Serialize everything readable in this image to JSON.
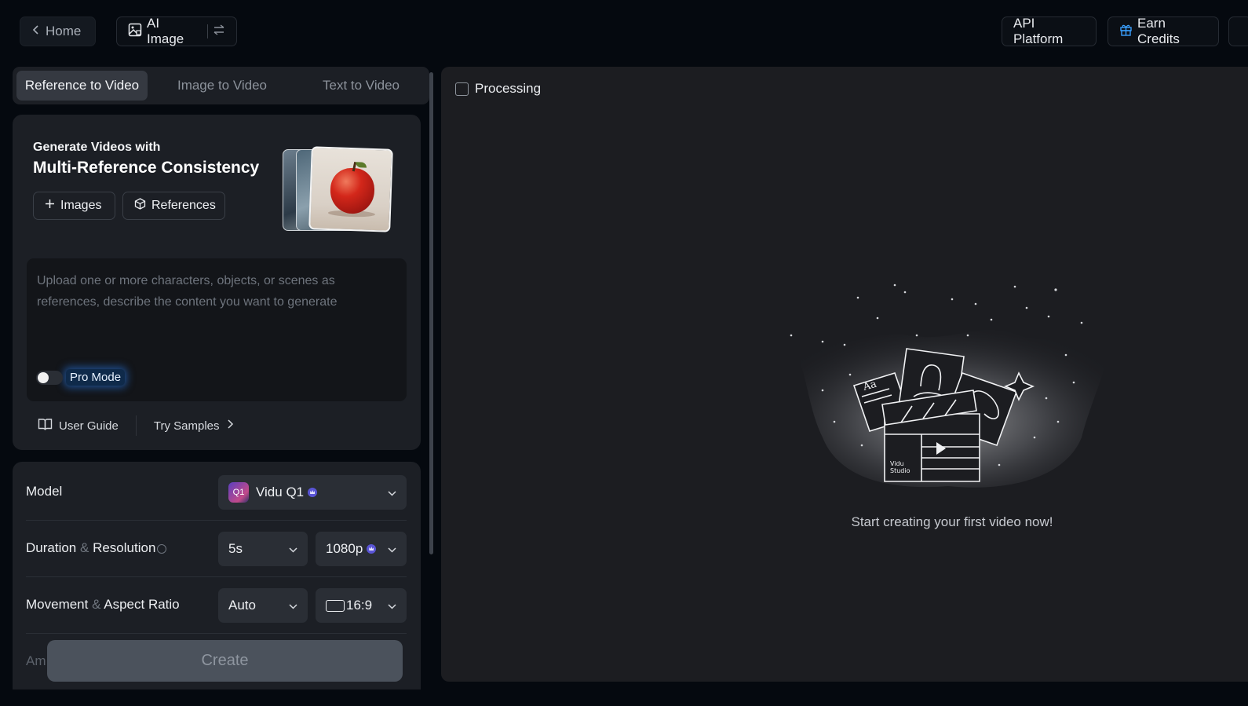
{
  "topbar": {
    "home_label": "Home",
    "ai_image_label": "AI Image",
    "api_platform_label": "API Platform",
    "earn_credits_label": "Earn Credits"
  },
  "tabs": [
    {
      "label": "Reference to Video",
      "active": true
    },
    {
      "label": "Image to Video",
      "active": false
    },
    {
      "label": "Text to Video",
      "active": false
    }
  ],
  "hero": {
    "subtitle": "Generate Videos with",
    "title": "Multi-Reference Consistency",
    "images_button": "Images",
    "references_button": "References"
  },
  "prompt": {
    "placeholder": "Upload one or more characters, objects, or scenes as references, describe the content you want to generate",
    "pro_mode_label": "Pro Mode",
    "pro_mode_on": false
  },
  "links": {
    "user_guide": "User Guide",
    "try_samples": "Try Samples"
  },
  "settings": {
    "model_label": "Model",
    "model_value": "Vidu Q1",
    "model_icon_text": "Q1",
    "duration_label_a": "Duration",
    "duration_label_amp": "&",
    "duration_label_b": "Resolution",
    "duration_value": "5s",
    "resolution_value": "1080p",
    "movement_label_a": "Movement",
    "movement_label_amp": "&",
    "movement_label_b": "Aspect Ratio",
    "movement_value": "Auto",
    "aspect_value": "16:9",
    "partial_label": "Am"
  },
  "create_label": "Create",
  "right": {
    "processing_label": "Processing",
    "empty_message": "Start creating your first video now!",
    "illustration_text_a": "Aa",
    "illustration_text_b": "Vidu",
    "illustration_text_c": "Studio"
  },
  "colors": {
    "background": "#05090f",
    "panel": "#1c1f25",
    "accent_glow": "#2878e6",
    "premium_crown": "#5a55d6",
    "earn_icon": "#3aa0ff"
  }
}
